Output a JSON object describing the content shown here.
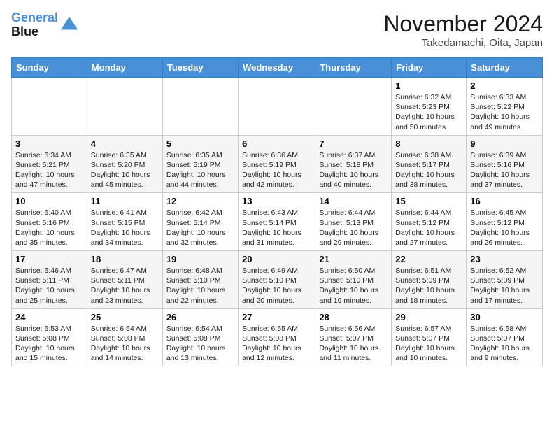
{
  "header": {
    "logo_line1": "General",
    "logo_line2": "Blue",
    "month": "November 2024",
    "location": "Takedamachi, Oita, Japan"
  },
  "weekdays": [
    "Sunday",
    "Monday",
    "Tuesday",
    "Wednesday",
    "Thursday",
    "Friday",
    "Saturday"
  ],
  "weeks": [
    [
      {
        "num": "",
        "info": ""
      },
      {
        "num": "",
        "info": ""
      },
      {
        "num": "",
        "info": ""
      },
      {
        "num": "",
        "info": ""
      },
      {
        "num": "",
        "info": ""
      },
      {
        "num": "1",
        "info": "Sunrise: 6:32 AM\nSunset: 5:23 PM\nDaylight: 10 hours and 50 minutes."
      },
      {
        "num": "2",
        "info": "Sunrise: 6:33 AM\nSunset: 5:22 PM\nDaylight: 10 hours and 49 minutes."
      }
    ],
    [
      {
        "num": "3",
        "info": "Sunrise: 6:34 AM\nSunset: 5:21 PM\nDaylight: 10 hours and 47 minutes."
      },
      {
        "num": "4",
        "info": "Sunrise: 6:35 AM\nSunset: 5:20 PM\nDaylight: 10 hours and 45 minutes."
      },
      {
        "num": "5",
        "info": "Sunrise: 6:35 AM\nSunset: 5:19 PM\nDaylight: 10 hours and 44 minutes."
      },
      {
        "num": "6",
        "info": "Sunrise: 6:36 AM\nSunset: 5:19 PM\nDaylight: 10 hours and 42 minutes."
      },
      {
        "num": "7",
        "info": "Sunrise: 6:37 AM\nSunset: 5:18 PM\nDaylight: 10 hours and 40 minutes."
      },
      {
        "num": "8",
        "info": "Sunrise: 6:38 AM\nSunset: 5:17 PM\nDaylight: 10 hours and 38 minutes."
      },
      {
        "num": "9",
        "info": "Sunrise: 6:39 AM\nSunset: 5:16 PM\nDaylight: 10 hours and 37 minutes."
      }
    ],
    [
      {
        "num": "10",
        "info": "Sunrise: 6:40 AM\nSunset: 5:16 PM\nDaylight: 10 hours and 35 minutes."
      },
      {
        "num": "11",
        "info": "Sunrise: 6:41 AM\nSunset: 5:15 PM\nDaylight: 10 hours and 34 minutes."
      },
      {
        "num": "12",
        "info": "Sunrise: 6:42 AM\nSunset: 5:14 PM\nDaylight: 10 hours and 32 minutes."
      },
      {
        "num": "13",
        "info": "Sunrise: 6:43 AM\nSunset: 5:14 PM\nDaylight: 10 hours and 31 minutes."
      },
      {
        "num": "14",
        "info": "Sunrise: 6:44 AM\nSunset: 5:13 PM\nDaylight: 10 hours and 29 minutes."
      },
      {
        "num": "15",
        "info": "Sunrise: 6:44 AM\nSunset: 5:12 PM\nDaylight: 10 hours and 27 minutes."
      },
      {
        "num": "16",
        "info": "Sunrise: 6:45 AM\nSunset: 5:12 PM\nDaylight: 10 hours and 26 minutes."
      }
    ],
    [
      {
        "num": "17",
        "info": "Sunrise: 6:46 AM\nSunset: 5:11 PM\nDaylight: 10 hours and 25 minutes."
      },
      {
        "num": "18",
        "info": "Sunrise: 6:47 AM\nSunset: 5:11 PM\nDaylight: 10 hours and 23 minutes."
      },
      {
        "num": "19",
        "info": "Sunrise: 6:48 AM\nSunset: 5:10 PM\nDaylight: 10 hours and 22 minutes."
      },
      {
        "num": "20",
        "info": "Sunrise: 6:49 AM\nSunset: 5:10 PM\nDaylight: 10 hours and 20 minutes."
      },
      {
        "num": "21",
        "info": "Sunrise: 6:50 AM\nSunset: 5:10 PM\nDaylight: 10 hours and 19 minutes."
      },
      {
        "num": "22",
        "info": "Sunrise: 6:51 AM\nSunset: 5:09 PM\nDaylight: 10 hours and 18 minutes."
      },
      {
        "num": "23",
        "info": "Sunrise: 6:52 AM\nSunset: 5:09 PM\nDaylight: 10 hours and 17 minutes."
      }
    ],
    [
      {
        "num": "24",
        "info": "Sunrise: 6:53 AM\nSunset: 5:08 PM\nDaylight: 10 hours and 15 minutes."
      },
      {
        "num": "25",
        "info": "Sunrise: 6:54 AM\nSunset: 5:08 PM\nDaylight: 10 hours and 14 minutes."
      },
      {
        "num": "26",
        "info": "Sunrise: 6:54 AM\nSunset: 5:08 PM\nDaylight: 10 hours and 13 minutes."
      },
      {
        "num": "27",
        "info": "Sunrise: 6:55 AM\nSunset: 5:08 PM\nDaylight: 10 hours and 12 minutes."
      },
      {
        "num": "28",
        "info": "Sunrise: 6:56 AM\nSunset: 5:07 PM\nDaylight: 10 hours and 11 minutes."
      },
      {
        "num": "29",
        "info": "Sunrise: 6:57 AM\nSunset: 5:07 PM\nDaylight: 10 hours and 10 minutes."
      },
      {
        "num": "30",
        "info": "Sunrise: 6:58 AM\nSunset: 5:07 PM\nDaylight: 10 hours and 9 minutes."
      }
    ]
  ]
}
